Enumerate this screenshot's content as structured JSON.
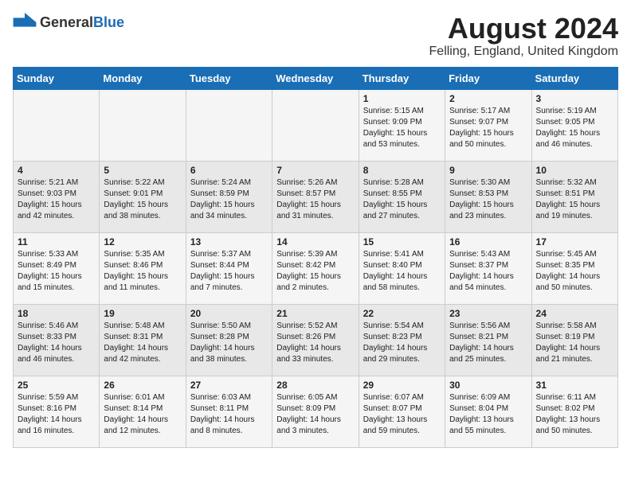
{
  "header": {
    "logo_general": "General",
    "logo_blue": "Blue",
    "month_year": "August 2024",
    "location": "Felling, England, United Kingdom"
  },
  "days_of_week": [
    "Sunday",
    "Monday",
    "Tuesday",
    "Wednesday",
    "Thursday",
    "Friday",
    "Saturday"
  ],
  "weeks": [
    [
      {
        "day": "",
        "sunrise": "",
        "sunset": "",
        "daylight": ""
      },
      {
        "day": "",
        "sunrise": "",
        "sunset": "",
        "daylight": ""
      },
      {
        "day": "",
        "sunrise": "",
        "sunset": "",
        "daylight": ""
      },
      {
        "day": "",
        "sunrise": "",
        "sunset": "",
        "daylight": ""
      },
      {
        "day": "1",
        "sunrise": "Sunrise: 5:15 AM",
        "sunset": "Sunset: 9:09 PM",
        "daylight": "Daylight: 15 hours and 53 minutes."
      },
      {
        "day": "2",
        "sunrise": "Sunrise: 5:17 AM",
        "sunset": "Sunset: 9:07 PM",
        "daylight": "Daylight: 15 hours and 50 minutes."
      },
      {
        "day": "3",
        "sunrise": "Sunrise: 5:19 AM",
        "sunset": "Sunset: 9:05 PM",
        "daylight": "Daylight: 15 hours and 46 minutes."
      }
    ],
    [
      {
        "day": "4",
        "sunrise": "Sunrise: 5:21 AM",
        "sunset": "Sunset: 9:03 PM",
        "daylight": "Daylight: 15 hours and 42 minutes."
      },
      {
        "day": "5",
        "sunrise": "Sunrise: 5:22 AM",
        "sunset": "Sunset: 9:01 PM",
        "daylight": "Daylight: 15 hours and 38 minutes."
      },
      {
        "day": "6",
        "sunrise": "Sunrise: 5:24 AM",
        "sunset": "Sunset: 8:59 PM",
        "daylight": "Daylight: 15 hours and 34 minutes."
      },
      {
        "day": "7",
        "sunrise": "Sunrise: 5:26 AM",
        "sunset": "Sunset: 8:57 PM",
        "daylight": "Daylight: 15 hours and 31 minutes."
      },
      {
        "day": "8",
        "sunrise": "Sunrise: 5:28 AM",
        "sunset": "Sunset: 8:55 PM",
        "daylight": "Daylight: 15 hours and 27 minutes."
      },
      {
        "day": "9",
        "sunrise": "Sunrise: 5:30 AM",
        "sunset": "Sunset: 8:53 PM",
        "daylight": "Daylight: 15 hours and 23 minutes."
      },
      {
        "day": "10",
        "sunrise": "Sunrise: 5:32 AM",
        "sunset": "Sunset: 8:51 PM",
        "daylight": "Daylight: 15 hours and 19 minutes."
      }
    ],
    [
      {
        "day": "11",
        "sunrise": "Sunrise: 5:33 AM",
        "sunset": "Sunset: 8:49 PM",
        "daylight": "Daylight: 15 hours and 15 minutes."
      },
      {
        "day": "12",
        "sunrise": "Sunrise: 5:35 AM",
        "sunset": "Sunset: 8:46 PM",
        "daylight": "Daylight: 15 hours and 11 minutes."
      },
      {
        "day": "13",
        "sunrise": "Sunrise: 5:37 AM",
        "sunset": "Sunset: 8:44 PM",
        "daylight": "Daylight: 15 hours and 7 minutes."
      },
      {
        "day": "14",
        "sunrise": "Sunrise: 5:39 AM",
        "sunset": "Sunset: 8:42 PM",
        "daylight": "Daylight: 15 hours and 2 minutes."
      },
      {
        "day": "15",
        "sunrise": "Sunrise: 5:41 AM",
        "sunset": "Sunset: 8:40 PM",
        "daylight": "Daylight: 14 hours and 58 minutes."
      },
      {
        "day": "16",
        "sunrise": "Sunrise: 5:43 AM",
        "sunset": "Sunset: 8:37 PM",
        "daylight": "Daylight: 14 hours and 54 minutes."
      },
      {
        "day": "17",
        "sunrise": "Sunrise: 5:45 AM",
        "sunset": "Sunset: 8:35 PM",
        "daylight": "Daylight: 14 hours and 50 minutes."
      }
    ],
    [
      {
        "day": "18",
        "sunrise": "Sunrise: 5:46 AM",
        "sunset": "Sunset: 8:33 PM",
        "daylight": "Daylight: 14 hours and 46 minutes."
      },
      {
        "day": "19",
        "sunrise": "Sunrise: 5:48 AM",
        "sunset": "Sunset: 8:31 PM",
        "daylight": "Daylight: 14 hours and 42 minutes."
      },
      {
        "day": "20",
        "sunrise": "Sunrise: 5:50 AM",
        "sunset": "Sunset: 8:28 PM",
        "daylight": "Daylight: 14 hours and 38 minutes."
      },
      {
        "day": "21",
        "sunrise": "Sunrise: 5:52 AM",
        "sunset": "Sunset: 8:26 PM",
        "daylight": "Daylight: 14 hours and 33 minutes."
      },
      {
        "day": "22",
        "sunrise": "Sunrise: 5:54 AM",
        "sunset": "Sunset: 8:23 PM",
        "daylight": "Daylight: 14 hours and 29 minutes."
      },
      {
        "day": "23",
        "sunrise": "Sunrise: 5:56 AM",
        "sunset": "Sunset: 8:21 PM",
        "daylight": "Daylight: 14 hours and 25 minutes."
      },
      {
        "day": "24",
        "sunrise": "Sunrise: 5:58 AM",
        "sunset": "Sunset: 8:19 PM",
        "daylight": "Daylight: 14 hours and 21 minutes."
      }
    ],
    [
      {
        "day": "25",
        "sunrise": "Sunrise: 5:59 AM",
        "sunset": "Sunset: 8:16 PM",
        "daylight": "Daylight: 14 hours and 16 minutes."
      },
      {
        "day": "26",
        "sunrise": "Sunrise: 6:01 AM",
        "sunset": "Sunset: 8:14 PM",
        "daylight": "Daylight: 14 hours and 12 minutes."
      },
      {
        "day": "27",
        "sunrise": "Sunrise: 6:03 AM",
        "sunset": "Sunset: 8:11 PM",
        "daylight": "Daylight: 14 hours and 8 minutes."
      },
      {
        "day": "28",
        "sunrise": "Sunrise: 6:05 AM",
        "sunset": "Sunset: 8:09 PM",
        "daylight": "Daylight: 14 hours and 3 minutes."
      },
      {
        "day": "29",
        "sunrise": "Sunrise: 6:07 AM",
        "sunset": "Sunset: 8:07 PM",
        "daylight": "Daylight: 13 hours and 59 minutes."
      },
      {
        "day": "30",
        "sunrise": "Sunrise: 6:09 AM",
        "sunset": "Sunset: 8:04 PM",
        "daylight": "Daylight: 13 hours and 55 minutes."
      },
      {
        "day": "31",
        "sunrise": "Sunrise: 6:11 AM",
        "sunset": "Sunset: 8:02 PM",
        "daylight": "Daylight: 13 hours and 50 minutes."
      }
    ]
  ]
}
